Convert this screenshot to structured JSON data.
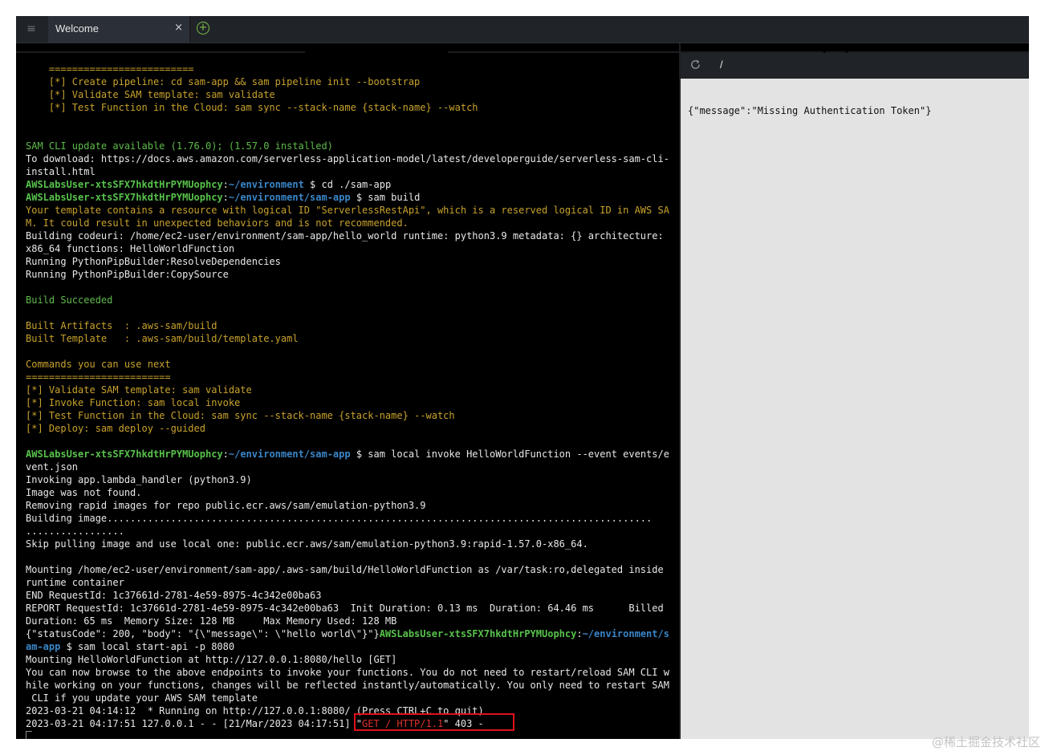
{
  "tabbar": {
    "tab_title": "Welcome",
    "close_glyph": "×",
    "add_glyph": "+",
    "menu_glyph": "≡"
  },
  "terminal": {
    "lines": [
      [
        {
          "c": "y",
          "t": "    ========================="
        }
      ],
      [
        {
          "c": "y",
          "t": "    [*] Create pipeline: cd sam-app && sam pipeline init --bootstrap"
        }
      ],
      [
        {
          "c": "y",
          "t": "    [*] Validate SAM template: sam validate"
        }
      ],
      [
        {
          "c": "y",
          "t": "    [*] Test Function in the Cloud: sam sync --stack-name {stack-name} --watch"
        }
      ],
      [
        {
          "c": "w",
          "t": ""
        }
      ],
      [
        {
          "c": "w",
          "t": ""
        }
      ],
      [
        {
          "c": "g",
          "t": "SAM CLI update available (1.76.0); (1.57.0 installed)"
        }
      ],
      [
        {
          "c": "w",
          "t": "To download: https://docs.aws.amazon.com/serverless-application-model/latest/developerguide/serverless-sam-cli-"
        }
      ],
      [
        {
          "c": "w",
          "t": "install.html"
        }
      ],
      [
        {
          "c": "gb",
          "t": "AWSLabsUser-xtsSFX7hkdtHrPYMUophcy"
        },
        {
          "c": "w",
          "t": ":"
        },
        {
          "c": "b",
          "t": "~/environment"
        },
        {
          "c": "w",
          "t": " $ cd ./sam-app"
        }
      ],
      [
        {
          "c": "gb",
          "t": "AWSLabsUser-xtsSFX7hkdtHrPYMUophcy"
        },
        {
          "c": "w",
          "t": ":"
        },
        {
          "c": "b",
          "t": "~/environment/sam-app"
        },
        {
          "c": "w",
          "t": " $ sam build"
        }
      ],
      [
        {
          "c": "y",
          "t": "Your template contains a resource with logical ID \"ServerlessRestApi\", which is a reserved logical ID in AWS SA"
        }
      ],
      [
        {
          "c": "y",
          "t": "M. It could result in unexpected behaviors and is not recommended."
        }
      ],
      [
        {
          "c": "w",
          "t": "Building codeuri: /home/ec2-user/environment/sam-app/hello_world runtime: python3.9 metadata: {} architecture:"
        }
      ],
      [
        {
          "c": "w",
          "t": "x86_64 functions: HelloWorldFunction"
        }
      ],
      [
        {
          "c": "w",
          "t": "Running PythonPipBuilder:ResolveDependencies"
        }
      ],
      [
        {
          "c": "w",
          "t": "Running PythonPipBuilder:CopySource"
        }
      ],
      [
        {
          "c": "w",
          "t": ""
        }
      ],
      [
        {
          "c": "g",
          "t": "Build Succeeded"
        }
      ],
      [
        {
          "c": "w",
          "t": ""
        }
      ],
      [
        {
          "c": "y",
          "t": "Built Artifacts  : .aws-sam/build"
        }
      ],
      [
        {
          "c": "y",
          "t": "Built Template   : .aws-sam/build/template.yaml"
        }
      ],
      [
        {
          "c": "w",
          "t": ""
        }
      ],
      [
        {
          "c": "y",
          "t": "Commands you can use next"
        }
      ],
      [
        {
          "c": "y",
          "t": "========================="
        }
      ],
      [
        {
          "c": "y",
          "t": "[*] Validate SAM template: sam validate"
        }
      ],
      [
        {
          "c": "y",
          "t": "[*] Invoke Function: sam local invoke"
        }
      ],
      [
        {
          "c": "y",
          "t": "[*] Test Function in the Cloud: sam sync --stack-name {stack-name} --watch"
        }
      ],
      [
        {
          "c": "y",
          "t": "[*] Deploy: sam deploy --guided"
        }
      ],
      [
        {
          "c": "w",
          "t": ""
        }
      ],
      [
        {
          "c": "gb",
          "t": "AWSLabsUser-xtsSFX7hkdtHrPYMUophcy"
        },
        {
          "c": "w",
          "t": ":"
        },
        {
          "c": "b",
          "t": "~/environment/sam-app"
        },
        {
          "c": "w",
          "t": " $ sam local invoke HelloWorldFunction --event events/e"
        }
      ],
      [
        {
          "c": "w",
          "t": "vent.json"
        }
      ],
      [
        {
          "c": "w",
          "t": "Invoking app.lambda_handler (python3.9)"
        }
      ],
      [
        {
          "c": "w",
          "t": "Image was not found."
        }
      ],
      [
        {
          "c": "w",
          "t": "Removing rapid images for repo public.ecr.aws/sam/emulation-python3.9"
        }
      ],
      [
        {
          "c": "w",
          "t": "Building image.............................................................................................."
        }
      ],
      [
        {
          "c": "w",
          "t": "................."
        }
      ],
      [
        {
          "c": "w",
          "t": "Skip pulling image and use local one: public.ecr.aws/sam/emulation-python3.9:rapid-1.57.0-x86_64."
        }
      ],
      [
        {
          "c": "w",
          "t": ""
        }
      ],
      [
        {
          "c": "w",
          "t": "Mounting /home/ec2-user/environment/sam-app/.aws-sam/build/HelloWorldFunction as /var/task:ro,delegated inside"
        }
      ],
      [
        {
          "c": "w",
          "t": "runtime container"
        }
      ],
      [
        {
          "c": "w",
          "t": "END RequestId: 1c37661d-2781-4e59-8975-4c342e00ba63"
        }
      ],
      [
        {
          "c": "w",
          "t": "REPORT RequestId: 1c37661d-2781-4e59-8975-4c342e00ba63  Init Duration: 0.13 ms  Duration: 64.46 ms      Billed"
        }
      ],
      [
        {
          "c": "w",
          "t": "Duration: 65 ms  Memory Size: 128 MB     Max Memory Used: 128 MB"
        }
      ],
      [
        {
          "c": "w",
          "t": "{\"statusCode\": 200, \"body\": \"{\\\"message\\\": \\\"hello world\\\"}\"}"
        },
        {
          "c": "gb",
          "t": "AWSLabsUser-xtsSFX7hkdtHrPYMUophcy"
        },
        {
          "c": "w",
          "t": ":"
        },
        {
          "c": "b",
          "t": "~/environment/s"
        }
      ],
      [
        {
          "c": "b",
          "t": "am-app"
        },
        {
          "c": "w",
          "t": " $ sam local start-api -p 8080"
        }
      ],
      [
        {
          "c": "w",
          "t": "Mounting HelloWorldFunction at http://127.0.0.1:8080/hello [GET]"
        }
      ],
      [
        {
          "c": "w",
          "t": "You can now browse to the above endpoints to invoke your functions. You do not need to restart/reload SAM CLI w"
        }
      ],
      [
        {
          "c": "w",
          "t": "hile working on your functions, changes will be reflected instantly/automatically. You only need to restart SAM"
        }
      ],
      [
        {
          "c": "w",
          "t": " CLI if you update your AWS SAM template"
        }
      ],
      [
        {
          "c": "w",
          "t": "2023-03-21 04:14:12  * Running on http://127.0.0.1:8080/ (Press CTRL+C to quit)"
        }
      ],
      [
        {
          "c": "w",
          "t": "2023-03-21 04:17:51 127.0.0.1 - - [21/Mar/2023 04:17:51] \""
        },
        {
          "c": "r",
          "t": "GET / HTTP/1.1"
        },
        {
          "c": "w",
          "t": "\" 403 -"
        }
      ]
    ]
  },
  "browser": {
    "url": "/",
    "body": "{\"message\":\"Missing Authentication Token\"}"
  },
  "watermark": "@稀土掘金技术社区"
}
